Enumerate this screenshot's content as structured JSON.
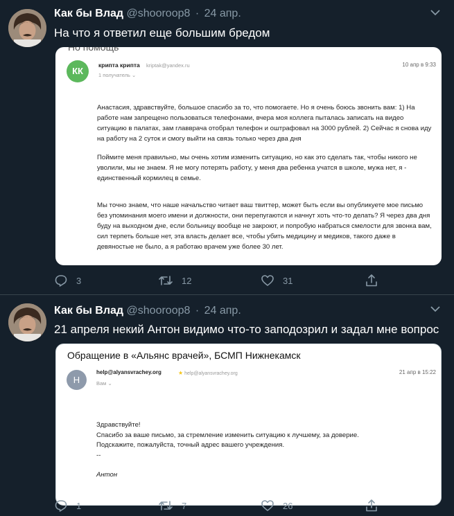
{
  "tweets": [
    {
      "author_name": "Как бы Влад",
      "handle": "@shooroop8",
      "separator": "·",
      "date": "24 апр.",
      "text": "На что я ответил еще большим бредом",
      "email": {
        "subject_partial": "Но помощь",
        "avatar_initials": "КК",
        "from_name": "крипта крипта",
        "from_address": "kriptak@yandex.ru",
        "recipients": "1 получатель",
        "date": "10 апр в 9:33",
        "paragraphs": [
          "Анастасия, здравствуйте, большое спасибо за то, что помогаете. Но я очень боюсь звонить вам: 1) На работе нам запрещено пользоваться телефонами, вчера моя коллега пыталась записать на видео ситуацию в палатах, зам главврача отобрал телефон и оштрафовал на 3000 рублей. 2) Сейчас я снова иду на работу на 2 суток и смогу выйти на связь только через два дня",
          "Поймите меня правильно, мы очень хотим изменить ситуацию, но как это сделать так, чтобы никого не уволили, мы не знаем. Я не могу потерять работу, у меня два ребенка учатся в школе, мужа нет, я - единственный кормилец в семье.",
          "Мы точно знаем, что наше начальство читает ваш твиттер, может быть если вы опубликуете мое письмо без упоминания моего имени и должности, они перепугаются и начнут хоть что-то делать? Я через два дня буду на выходном дне, если больницу вообще не закроют, и попробую набраться смелости для звонка вам, сил терпеть больше нет, эта власть делает все, чтобы убить медицину и медиков, такого даже в девяностые не было, а я работаю врачем уже более 30 лет."
        ]
      },
      "counts": {
        "replies": "3",
        "retweets": "12",
        "likes": "31"
      }
    },
    {
      "author_name": "Как бы Влад",
      "handle": "@shooroop8",
      "separator": "·",
      "date": "24 апр.",
      "text": "21 апреля некий Антон видимо что-то заподозрил и задал мне вопрос",
      "email": {
        "subject": "Обращение в «Альянс врачей», БСМП Нижнекамск",
        "avatar_initial": "H",
        "from_name": "help@alyansvrachey.org",
        "from_address": "help@alyansvrachey.org",
        "to": "Вам",
        "date": "21 апр в 15:22",
        "lines": [
          "Здравствуйте!",
          "Спасибо за ваше письмо, за стремление изменить ситуацию к лучшему, за доверие.",
          "Подскажите, пожалуйста, точный адрес вашего учреждения.",
          "--"
        ],
        "signature": "Антон"
      },
      "counts": {
        "replies": "1",
        "retweets": "7",
        "likes": "26"
      }
    }
  ],
  "icons": {
    "reply": "reply-icon",
    "retweet": "retweet-icon",
    "like": "heart-icon",
    "share": "share-icon",
    "menu": "chevron-down-icon"
  },
  "colors": {
    "background": "#15202b",
    "secondary_text": "#8899a6",
    "kk_avatar": "#5cb85c",
    "h_avatar": "#8e9aab"
  }
}
